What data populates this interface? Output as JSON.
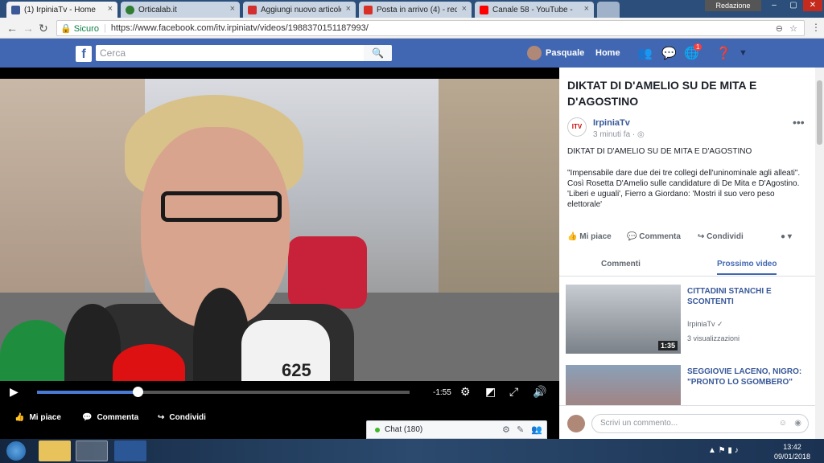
{
  "browser": {
    "tabs": [
      {
        "title": "(1) IrpiniaTv - Home",
        "favicon_color": "#3b5998",
        "active": true
      },
      {
        "title": "Orticalab.it",
        "favicon_color": "#2f7d32",
        "active": false
      },
      {
        "title": "Aggiungi nuovo articolo",
        "favicon_color": "#d32f2f",
        "active": false
      },
      {
        "title": "Posta in arrivo (4) - redaz",
        "favicon_color": "#d93025",
        "active": false
      },
      {
        "title": "Canale 58 - YouTube - Yo",
        "favicon_color": "#ff0000",
        "active": false
      }
    ],
    "profile_label": "Redazione",
    "secure_label": "Sicuro",
    "url": "https://www.facebook.com/itv.irpiniatv/videos/1988370151187993/"
  },
  "fb_header": {
    "logo": "f",
    "search_placeholder": "Cerca",
    "user_name": "Pasquale",
    "home_label": "Home",
    "notification_count": "1"
  },
  "video": {
    "mic_label": "625",
    "time_remaining": "-1:55",
    "progress": 0.27
  },
  "video_actions": {
    "like": "Mi piace",
    "comment": "Commenta",
    "share": "Condividi"
  },
  "post": {
    "title": "DIKTAT DI D'AMELIO SU DE MITA E D'AGOSTINO",
    "page_avatar_text": "ITV",
    "page_name": "IrpiniaTv",
    "time": "3 minuti fa · ",
    "line1": "DIKTAT DI D'AMELIO SU DE MITA E D'AGOSTINO",
    "body": "\"Impensabile dare due dei tre collegi dell'uninominale agli alleati\". Così Rosetta D'Amelio sulle candidature di De Mita e D'Agostino. 'Liberi e uguali', Fierro a Giordano: 'Mostri il suo vero peso elettorale'",
    "actions": {
      "like": "Mi piace",
      "comment": "Commenta",
      "share": "Condividi"
    },
    "tabs": {
      "comments": "Commenti",
      "next": "Prossimo video"
    }
  },
  "suggestions": [
    {
      "title": "CITTADINI STANCHI E SCONTENTI",
      "channel": "IrpiniaTv",
      "views": "3 visualizzazioni",
      "duration": "1:35"
    },
    {
      "title": "SEGGIOVIE LACENO, NIGRO: \"PRONTO LO SGOMBERO\"",
      "channel": "",
      "views": "",
      "duration": ""
    }
  ],
  "comment_input_placeholder": "Scrivi un commento...",
  "chat": {
    "label": "Chat (180)"
  },
  "taskbar": {
    "time": "13:42",
    "date": "09/01/2018"
  }
}
